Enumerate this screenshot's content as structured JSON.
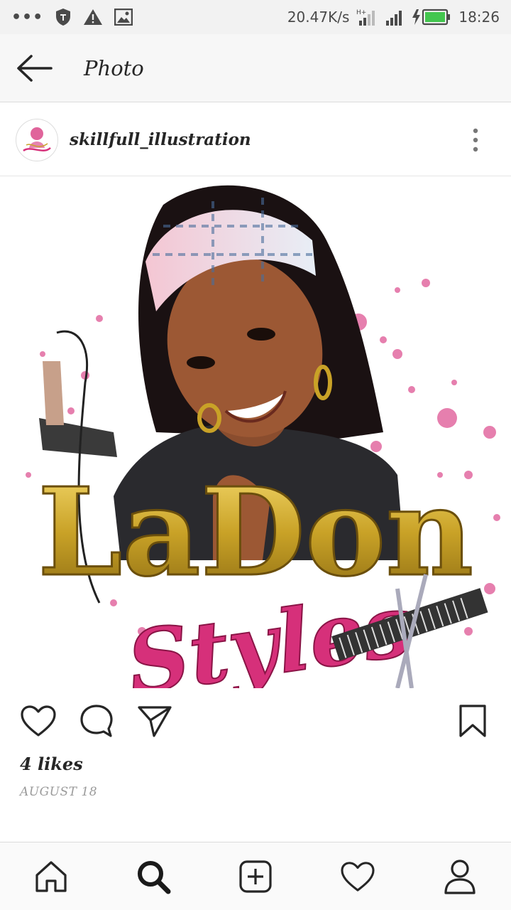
{
  "status_bar": {
    "left_icons": [
      "more-dots-icon",
      "vpn-shield-icon",
      "warning-icon",
      "image-icon"
    ],
    "speed": "20.47K/s",
    "network": "H+",
    "time": "18:26"
  },
  "app_bar": {
    "back_icon": "arrow-left-icon",
    "title": "Photo"
  },
  "post": {
    "username": "skillfull_illustration",
    "avatar_alt": "profile avatar",
    "image": {
      "description_words": [
        "LaDon",
        "Styles"
      ],
      "colors": {
        "gold": "#c9a227",
        "pink": "#d6307a",
        "splatter": "#e0609a"
      }
    },
    "likes": "4 likes",
    "date": "AUGUST 18"
  },
  "actions": {
    "like_icon": "heart-icon",
    "comment_icon": "comment-icon",
    "share_icon": "send-icon",
    "save_icon": "bookmark-icon"
  },
  "bottom_nav": {
    "items": [
      "home-icon",
      "search-icon",
      "add-icon",
      "activity-heart-icon",
      "profile-icon"
    ]
  }
}
